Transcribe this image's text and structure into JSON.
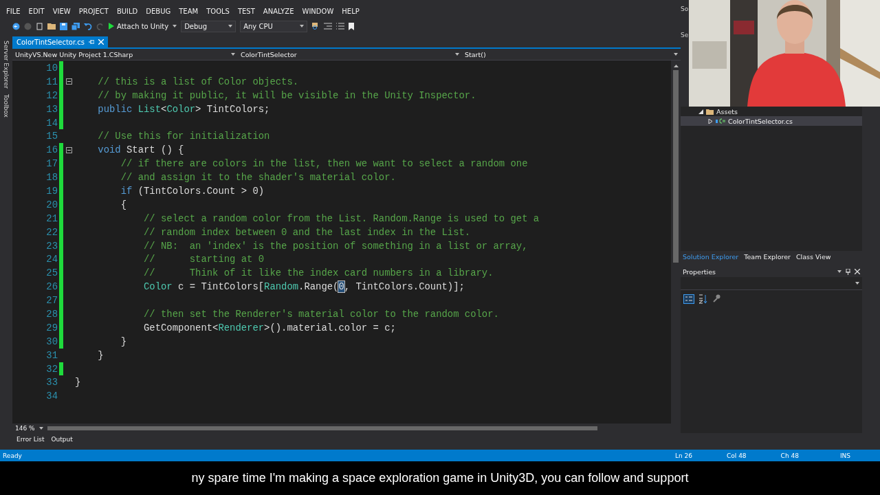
{
  "menu": [
    "FILE",
    "EDIT",
    "VIEW",
    "PROJECT",
    "BUILD",
    "DEBUG",
    "TEAM",
    "TOOLS",
    "TEST",
    "ANALYZE",
    "WINDOW",
    "HELP"
  ],
  "toolbar": {
    "run_label": "Attach to Unity",
    "configuration": "Debug",
    "platform": "Any CPU"
  },
  "side_tabs": [
    "Server Explorer",
    "Toolbox"
  ],
  "document_tabs": [
    {
      "label": "ColorTintSelector.cs",
      "selected": true
    }
  ],
  "nav_bar": [
    "UnityVS.New Unity Project 1.CSharp",
    "ColorTintSelector",
    "Start()"
  ],
  "code_lines": [
    {
      "number": "10",
      "changed": true,
      "fold": false
    },
    {
      "number": "11",
      "changed": true,
      "fold": true,
      "tokens": [
        {
          "comment": "    // this is a list of Color objects."
        }
      ]
    },
    {
      "number": "12",
      "changed": true,
      "fold": false,
      "tokens": [
        {
          "comment": "    // by making it public, it will be visible in the Unity Inspector."
        }
      ]
    },
    {
      "number": "13",
      "changed": true,
      "fold": false,
      "tokens": [
        {
          "keyword": "    public "
        },
        {
          "type": "List"
        },
        {
          "plain": "<"
        },
        {
          "type": "Color"
        },
        {
          "plain": "> TintColors;"
        }
      ]
    },
    {
      "number": "14",
      "changed": true,
      "fold": false
    },
    {
      "number": "15",
      "changed": false,
      "fold": false,
      "tokens": [
        {
          "comment": "    // Use this for initialization"
        }
      ]
    },
    {
      "number": "16",
      "changed": true,
      "fold": true,
      "tokens": [
        {
          "keyword": "    void "
        },
        {
          "plain": "Start () {"
        }
      ]
    },
    {
      "number": "17",
      "changed": true,
      "fold": false,
      "tokens": [
        {
          "comment": "        // if there are colors in the list, then we want to select a random one"
        }
      ]
    },
    {
      "number": "18",
      "changed": true,
      "fold": false,
      "tokens": [
        {
          "comment": "        // and assign it to the shader's material color."
        }
      ]
    },
    {
      "number": "19",
      "changed": true,
      "fold": false,
      "tokens": [
        {
          "keyword": "        if "
        },
        {
          "plain": "(TintColors.Count > 0)"
        }
      ]
    },
    {
      "number": "20",
      "changed": true,
      "fold": false,
      "tokens": [
        {
          "plain": "        {"
        }
      ]
    },
    {
      "number": "21",
      "changed": true,
      "fold": false,
      "tokens": [
        {
          "comment": "            // select a random color from the List. Random.Range is used to get a"
        }
      ]
    },
    {
      "number": "22",
      "changed": true,
      "fold": false,
      "tokens": [
        {
          "comment": "            // random index between 0 and the last index in the List."
        }
      ]
    },
    {
      "number": "23",
      "changed": true,
      "fold": false,
      "tokens": [
        {
          "comment": "            // NB:  an 'index' is the position of something in a list or array,"
        }
      ]
    },
    {
      "number": "24",
      "changed": true,
      "fold": false,
      "tokens": [
        {
          "comment": "            //      starting at 0"
        }
      ]
    },
    {
      "number": "25",
      "changed": true,
      "fold": false,
      "tokens": [
        {
          "comment": "            //      Think of it like the index card numbers in a library."
        }
      ]
    },
    {
      "number": "26",
      "changed": true,
      "fold": false,
      "tokens": [
        {
          "type": "            Color "
        },
        {
          "plain": "c = TintColors["
        },
        {
          "type": "Random"
        },
        {
          "plain": ".Range("
        },
        {
          "selected": "0"
        },
        {
          "plain": ", TintColors.Count)];"
        }
      ]
    },
    {
      "number": "27",
      "changed": true,
      "fold": false
    },
    {
      "number": "28",
      "changed": true,
      "fold": false,
      "tokens": [
        {
          "comment": "            // then set the Renderer's material color to the random color."
        }
      ]
    },
    {
      "number": "29",
      "changed": true,
      "fold": false,
      "tokens": [
        {
          "plain": "            GetComponent<"
        },
        {
          "type": "Renderer"
        },
        {
          "plain": ">().material.color = c;"
        }
      ]
    },
    {
      "number": "30",
      "changed": true,
      "fold": false,
      "tokens": [
        {
          "plain": "        }"
        }
      ]
    },
    {
      "number": "31",
      "changed": false,
      "fold": false,
      "tokens": [
        {
          "plain": "    }"
        }
      ]
    },
    {
      "number": "32",
      "changed": true,
      "fold": false
    },
    {
      "number": "33",
      "changed": false,
      "fold": false,
      "tokens": [
        {
          "plain": "}"
        }
      ]
    },
    {
      "number": "34",
      "changed": false,
      "fold": false
    }
  ],
  "zoom": "146 %",
  "solution_explorer": {
    "header_fragment": "So",
    "search_fragment": "Se",
    "items": [
      {
        "label": "Assets",
        "selected": false,
        "expanded": true,
        "children": [
          {
            "label": "ColorTintSelector.cs",
            "selected": true,
            "expanded": false
          }
        ]
      }
    ]
  },
  "panel_tabs": [
    {
      "label": "Solution Explorer",
      "selected": true
    },
    {
      "label": "Team Explorer",
      "selected": false
    },
    {
      "label": "Class View",
      "selected": false
    }
  ],
  "properties": {
    "title": "Properties"
  },
  "bottom_tabs": [
    "Error List",
    "Output"
  ],
  "status_bar": {
    "status": "Ready",
    "line": "Ln 26",
    "column": "Col 48",
    "char": "Ch 48",
    "mode": "INS"
  },
  "caption": "ny spare time I'm making a space exploration game in Unity3D, you can follow and support"
}
